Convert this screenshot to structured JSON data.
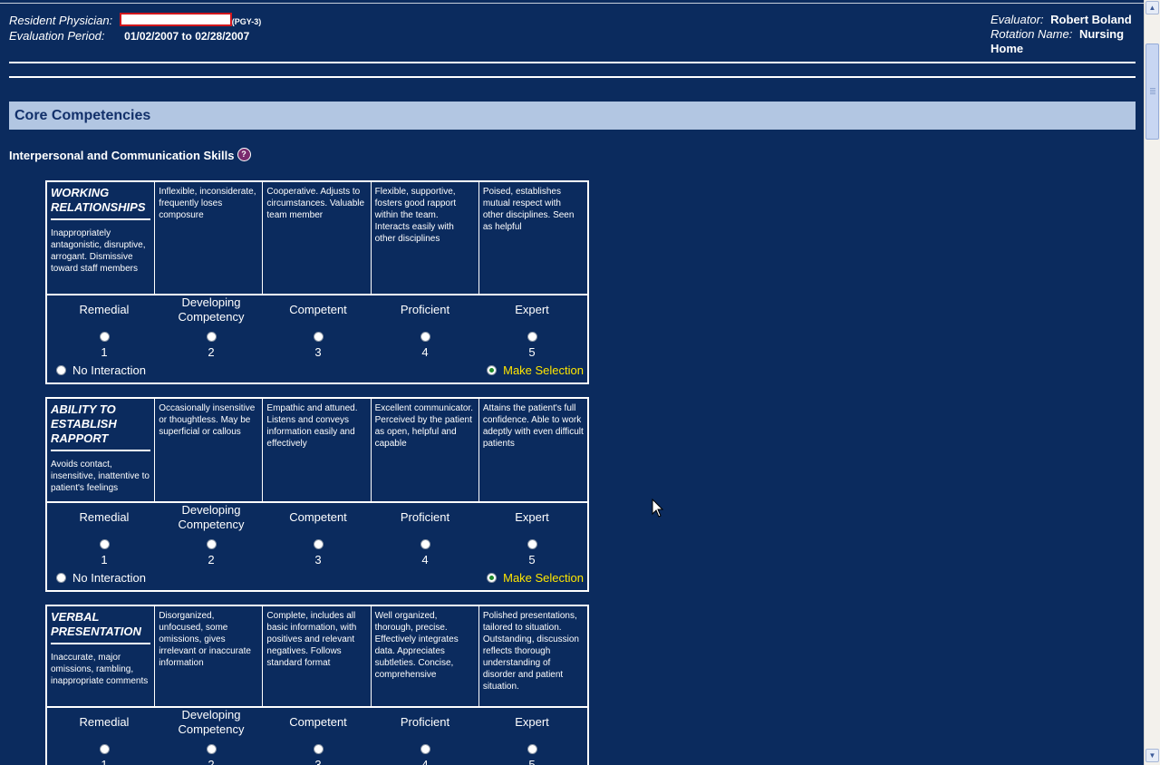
{
  "header": {
    "resident_label": "Resident Physician:",
    "pgy": "(PGY-3)",
    "period_label": "Evaluation Period:",
    "period_value": "01/02/2007 to 02/28/2007",
    "evaluator_label": "Evaluator:",
    "evaluator_value": "Robert Boland",
    "rotation_label": "Rotation Name:",
    "rotation_value": "Nursing Home"
  },
  "section_title": "Core Competencies",
  "subsection_title": "Interpersonal and Communication Skills",
  "help_glyph": "?",
  "rating_labels": [
    "Remedial",
    "Developing Competency",
    "Competent",
    "Proficient",
    "Expert"
  ],
  "rating_numbers": [
    "1",
    "2",
    "3",
    "4",
    "5"
  ],
  "no_interaction": "No Interaction",
  "make_selection": "Make Selection",
  "competencies": [
    {
      "title": "WORKING RELATIONSHIPS",
      "descriptions": [
        "Inappropriately antagonistic, disruptive, arrogant. Dismissive toward staff members",
        "Inflexible, inconsiderate, frequently loses composure",
        "Cooperative. Adjusts to circumstances. Valuable team member",
        "Flexible, supportive, fosters good rapport within the team. Interacts easily with other disciplines",
        "Poised, establishes mutual respect with other disciplines. Seen as helpful"
      ]
    },
    {
      "title": "ABILITY TO ESTABLISH RAPPORT",
      "descriptions": [
        "Avoids contact, insensitive, inattentive to patient's feelings",
        "Occasionally insensitive or thoughtless. May be superficial or callous",
        "Empathic and attuned. Listens and conveys information easily and effectively",
        "Excellent communicator. Perceived by the patient as open, helpful and capable",
        "Attains the patient's full confidence. Able to work adeptly with even difficult patients"
      ]
    },
    {
      "title": "VERBAL PRESENTATION",
      "descriptions": [
        "Inaccurate, major omissions, rambling, inappropriate comments",
        "Disorganized, unfocused, some omissions, gives irrelevant or inaccurate information",
        "Complete, includes all basic information, with positives and relevant negatives. Follows standard format",
        "Well organized, thorough, precise. Effectively integrates data. Appreciates subtleties. Concise, comprehensive",
        "Polished presentations, tailored to situation. Outstanding, discussion reflects thorough understanding of disorder and patient situation."
      ]
    }
  ],
  "colors": {
    "page_bg": "#0b2b5e",
    "section_bar_bg": "#b2c6e2",
    "section_bar_text": "#12306a",
    "make_selection": "#ffe600"
  }
}
